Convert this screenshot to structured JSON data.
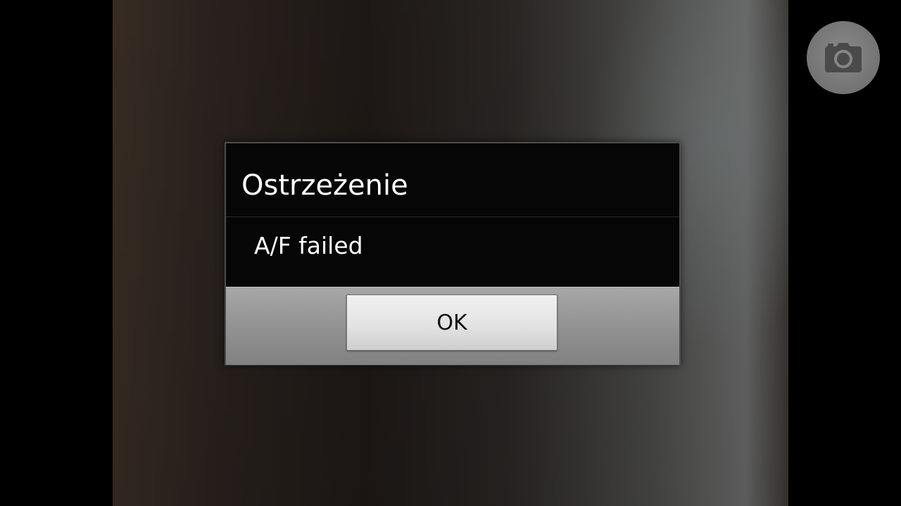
{
  "dialog": {
    "title": "Ostrzeżenie",
    "message": "A/F failed",
    "ok_label": "OK"
  },
  "camera": {
    "shutter_icon": "camera-icon"
  },
  "colors": {
    "dialog_background": "#060606",
    "button_bar": "#999999",
    "shutter_button": "#777777"
  }
}
